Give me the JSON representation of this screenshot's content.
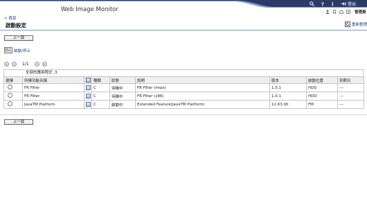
{
  "header": {
    "title": "Web Image Monitor",
    "top_icons": [
      {
        "name": "search-icon",
        "label": ""
      },
      {
        "name": "help-icon",
        "label": ""
      },
      {
        "name": "info-icon",
        "label": ""
      },
      {
        "name": "logout-icon",
        "label": "登出"
      }
    ],
    "sub_icons": [
      "user-icon",
      "bookmark-icon",
      "home-icon",
      "list-icon"
    ],
    "admin_label": "管理員"
  },
  "nav": {
    "home_link": "< 首頁"
  },
  "page": {
    "title": "啟動設定",
    "refresh_label": "重新整理",
    "back_button_top": "上一頁",
    "back_button_bottom": "上一頁",
    "start_stop_label": "啟動/停止",
    "start_stop_icon_text": "起止"
  },
  "pager": {
    "text": "1/1"
  },
  "table": {
    "count_text": "全部的應用程式 :3",
    "headers": [
      "選擇",
      "所擇功能名稱",
      "",
      "種類",
      "狀態",
      "說明",
      "版本",
      "啟動位置",
      "到期日"
    ],
    "rows": [
      {
        "name": "FR Filter",
        "type": "C",
        "status": "待機中",
        "desc": "FR Filter (mips)",
        "version": "1.0.1",
        "location": "HDD",
        "expiry": "---"
      },
      {
        "name": "FR Filter",
        "type": "C",
        "status": "待機中",
        "desc": "FR Filter (x86)",
        "version": "1.0.1",
        "location": "HDD",
        "expiry": "---"
      },
      {
        "name": "JavaTM Platform",
        "type": "C",
        "status": "啟動中",
        "desc": "Extended Feature(JavaTM Platform)",
        "version": "12.63.00",
        "location": "FM",
        "expiry": "---"
      }
    ]
  },
  "colors": {
    "header_navy": "#2b3a67",
    "header_light": "#8898c0",
    "link_blue": "#223c8a",
    "table_header_bg": "#eeeeee"
  }
}
